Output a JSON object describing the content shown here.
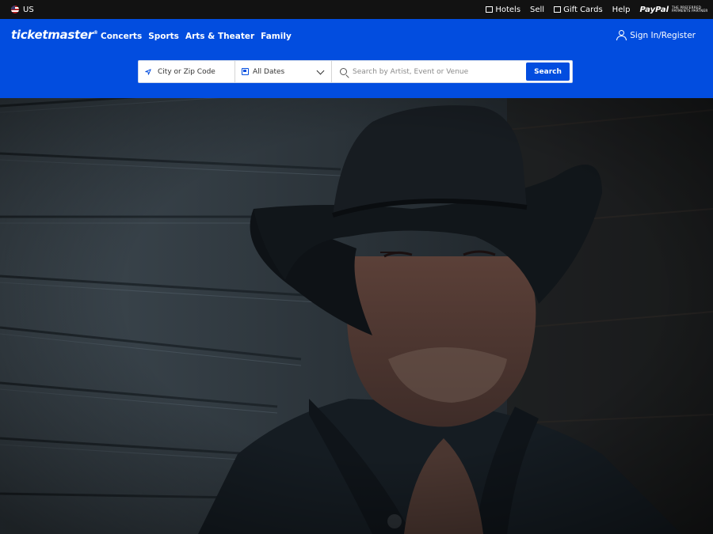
{
  "topbar": {
    "region": "US",
    "links": [
      "Hotels",
      "Sell",
      "Gift Cards",
      "Help"
    ],
    "paypal": {
      "brand": "PayPal",
      "tagline": "THE PREFERRED PAYMENTS PARTNER"
    }
  },
  "header": {
    "logo": "ticketmaster",
    "nav": [
      "Concerts",
      "Sports",
      "Arts & Theater",
      "Family"
    ],
    "signin": "Sign In/Register"
  },
  "search": {
    "location_placeholder": "City or Zip Code",
    "date_value": "All Dates",
    "query_placeholder": "Search by Artist, Event or Venue",
    "button": "Search"
  },
  "colors": {
    "brand": "#024ddf",
    "topbar": "#121212"
  },
  "icons": [
    "flag-icon",
    "hotel-icon",
    "gift-card-icon",
    "location-arrow-icon",
    "calendar-icon",
    "chevron-down-icon",
    "search-icon",
    "user-icon"
  ]
}
